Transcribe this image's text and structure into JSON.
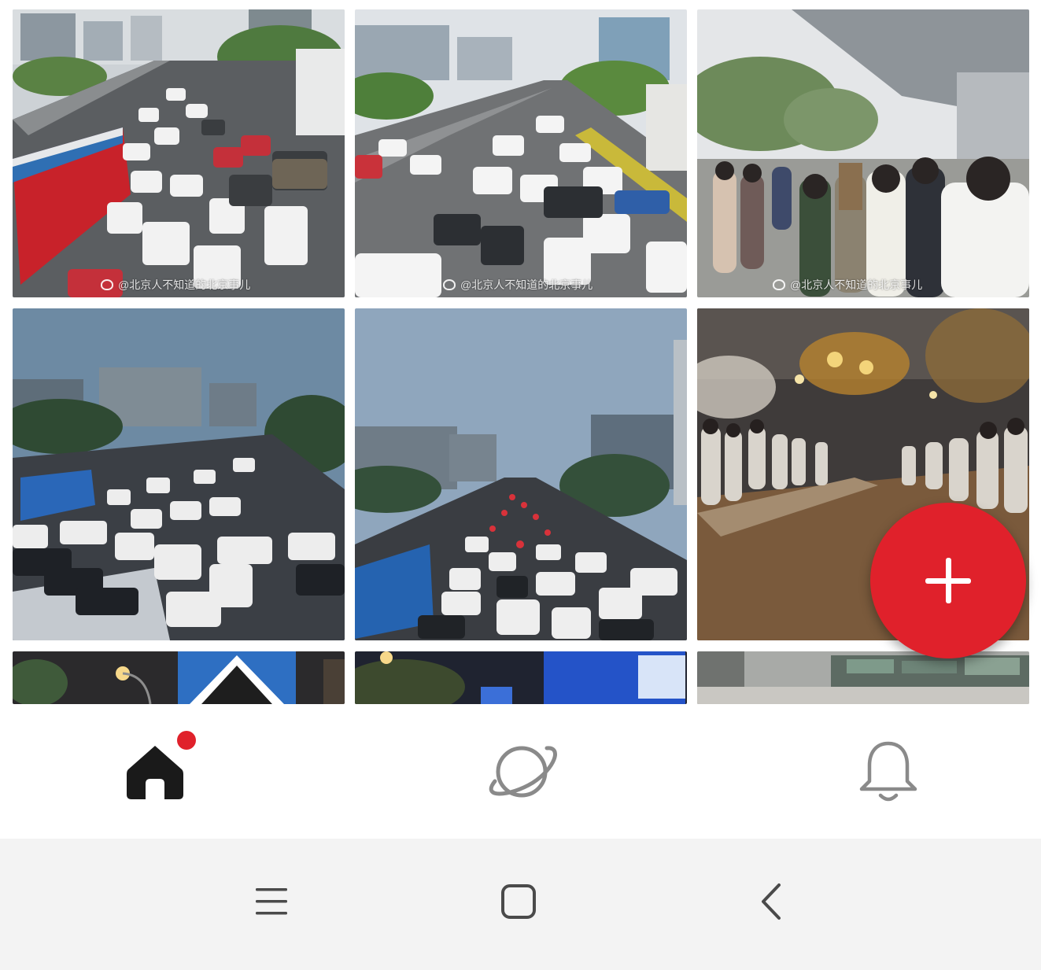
{
  "photo_grid": {
    "tiles": [
      {
        "kind": "traffic-jam-day",
        "watermark": "@北京人不知道的北京事儿"
      },
      {
        "kind": "traffic-jam-wide",
        "watermark": "@北京人不知道的北京事儿"
      },
      {
        "kind": "crowd-station",
        "watermark": "@北京人不知道的北京事儿"
      },
      {
        "kind": "traffic-jam-dusk",
        "watermark": ""
      },
      {
        "kind": "traffic-jam-evening",
        "watermark": ""
      },
      {
        "kind": "crowd-night-street",
        "watermark": ""
      },
      {
        "kind": "night-crosswalk-sign",
        "watermark": ""
      },
      {
        "kind": "night-street-screen",
        "watermark": ""
      },
      {
        "kind": "graffiti-wall",
        "watermark": ""
      }
    ]
  },
  "fab": {
    "icon": "plus-icon",
    "color": "#e0212b"
  },
  "bottom_nav": {
    "items": [
      {
        "name": "home",
        "icon": "home-icon",
        "active": true,
        "badge": true
      },
      {
        "name": "discover",
        "icon": "planet-icon",
        "active": false,
        "badge": false
      },
      {
        "name": "notifications",
        "icon": "bell-icon",
        "active": false,
        "badge": false
      }
    ],
    "badge_color": "#e0212b"
  },
  "system_nav": {
    "buttons": [
      {
        "name": "menu",
        "icon": "menu-icon"
      },
      {
        "name": "home",
        "icon": "square-home-icon"
      },
      {
        "name": "back",
        "icon": "back-chevron-icon"
      }
    ]
  }
}
